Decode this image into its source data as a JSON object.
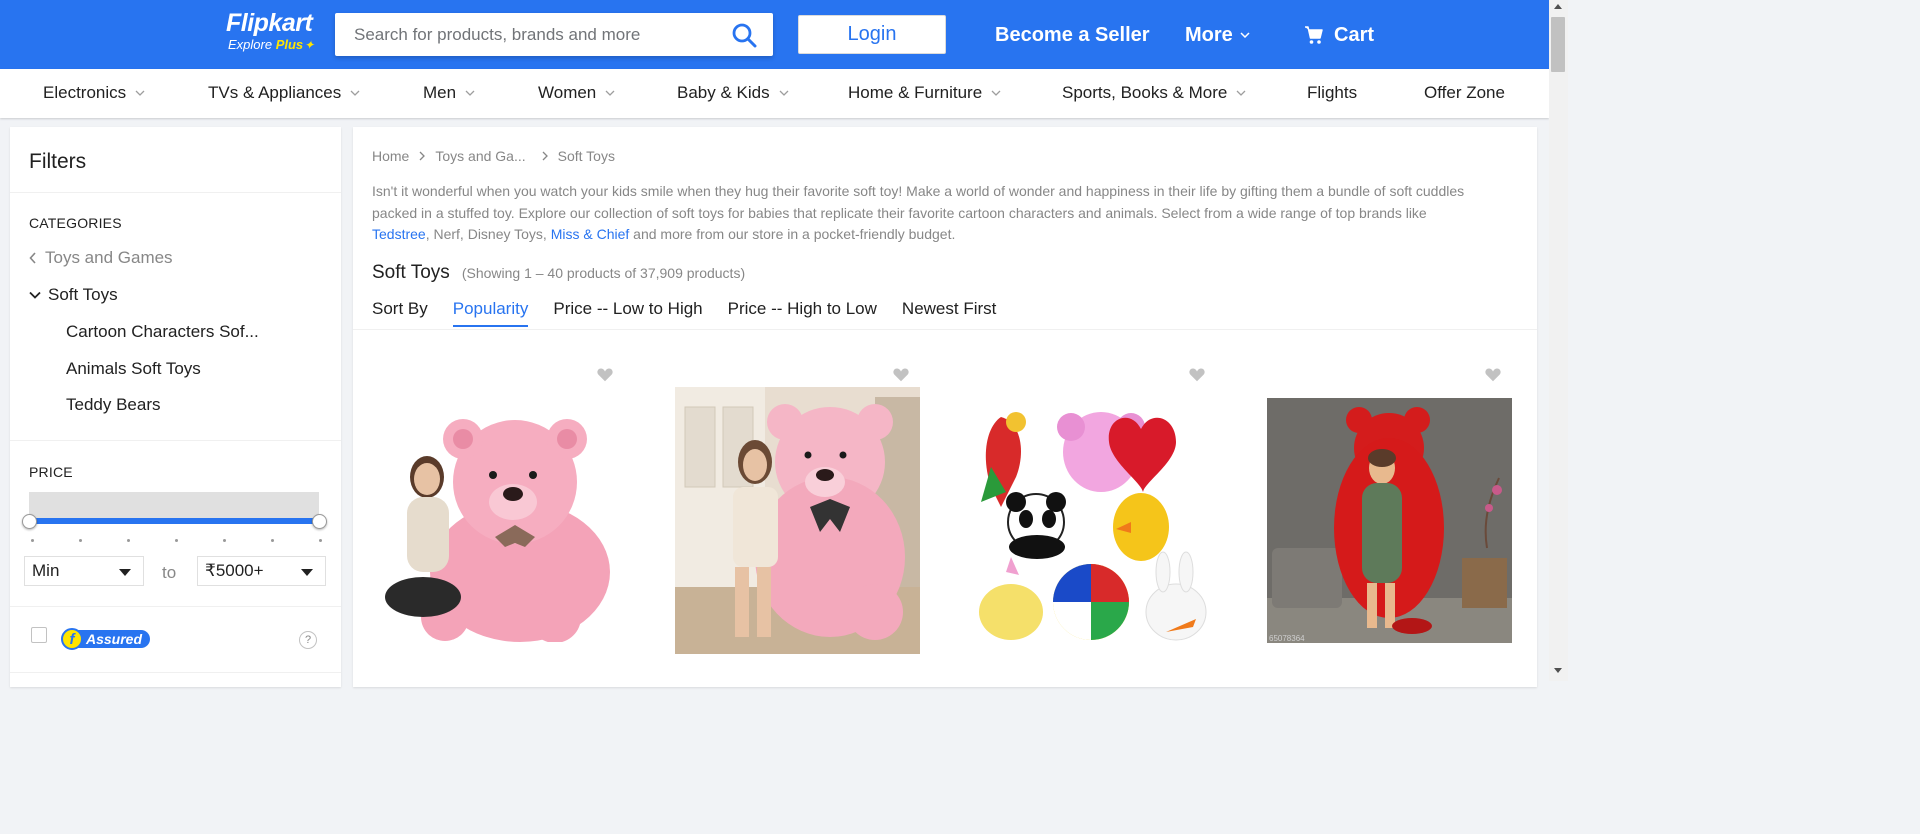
{
  "header": {
    "logo": "Flipkart",
    "logo_sub_explore": "Explore",
    "logo_sub_plus": "Plus",
    "search_placeholder": "Search for products, brands and more",
    "login_label": "Login",
    "seller_label": "Become a Seller",
    "more_label": "More",
    "cart_label": "Cart",
    "colors": {
      "brand": "#2874f0",
      "accent": "#ffe500"
    }
  },
  "categories": [
    {
      "label": "Electronics",
      "has_dropdown": true
    },
    {
      "label": "TVs & Appliances",
      "has_dropdown": true
    },
    {
      "label": "Men",
      "has_dropdown": true
    },
    {
      "label": "Women",
      "has_dropdown": true
    },
    {
      "label": "Baby & Kids",
      "has_dropdown": true
    },
    {
      "label": "Home & Furniture",
      "has_dropdown": true
    },
    {
      "label": "Sports, Books & More",
      "has_dropdown": true
    },
    {
      "label": "Flights",
      "has_dropdown": false
    },
    {
      "label": "Offer Zone",
      "has_dropdown": false
    }
  ],
  "filters": {
    "title": "Filters",
    "categories_heading": "CATEGORIES",
    "parent_category": "Toys and Games",
    "current_category": "Soft Toys",
    "subcategories": [
      "Cartoon Characters Sof...",
      "Animals Soft Toys",
      "Teddy Bears"
    ],
    "price_heading": "PRICE",
    "price_min": "Min",
    "price_to": "to",
    "price_max": "₹5000+",
    "assured_letter": "f",
    "assured_label": "Assured",
    "help_label": "?"
  },
  "main": {
    "breadcrumbs": [
      "Home",
      "Toys and Ga...",
      "Soft Toys"
    ],
    "description": {
      "part1": "Isn't it wonderful when you watch your kids smile when they hug their favorite soft toy! Make a world of wonder and happiness in their life by gifting them a bundle of soft cuddles packed in a stuffed toy. Explore our collection of soft toys for babies that replicate their favorite cartoon characters and animals. Select from a wide range of top brands like ",
      "link1": "Tedstree",
      "part2": ", Nerf, Disney Toys, ",
      "link2": "Miss & Chief",
      "part3": " and more from our store in a pocket-friendly budget."
    },
    "results_title": "Soft Toys",
    "results_count": "(Showing 1 – 40 products of 37,909 products)",
    "sort_label": "Sort By",
    "sort_options": [
      "Popularity",
      "Price -- Low to High",
      "Price -- High to Low",
      "Newest First"
    ],
    "active_sort": "Popularity"
  },
  "products": [
    {
      "image": "woman-with-pink-teddy-bear"
    },
    {
      "image": "woman-sitting-with-pink-teddy-bear"
    },
    {
      "image": "soft-toys-bundle"
    },
    {
      "image": "woman-hugging-red-teddy-bear",
      "watermark": "65078364"
    }
  ]
}
